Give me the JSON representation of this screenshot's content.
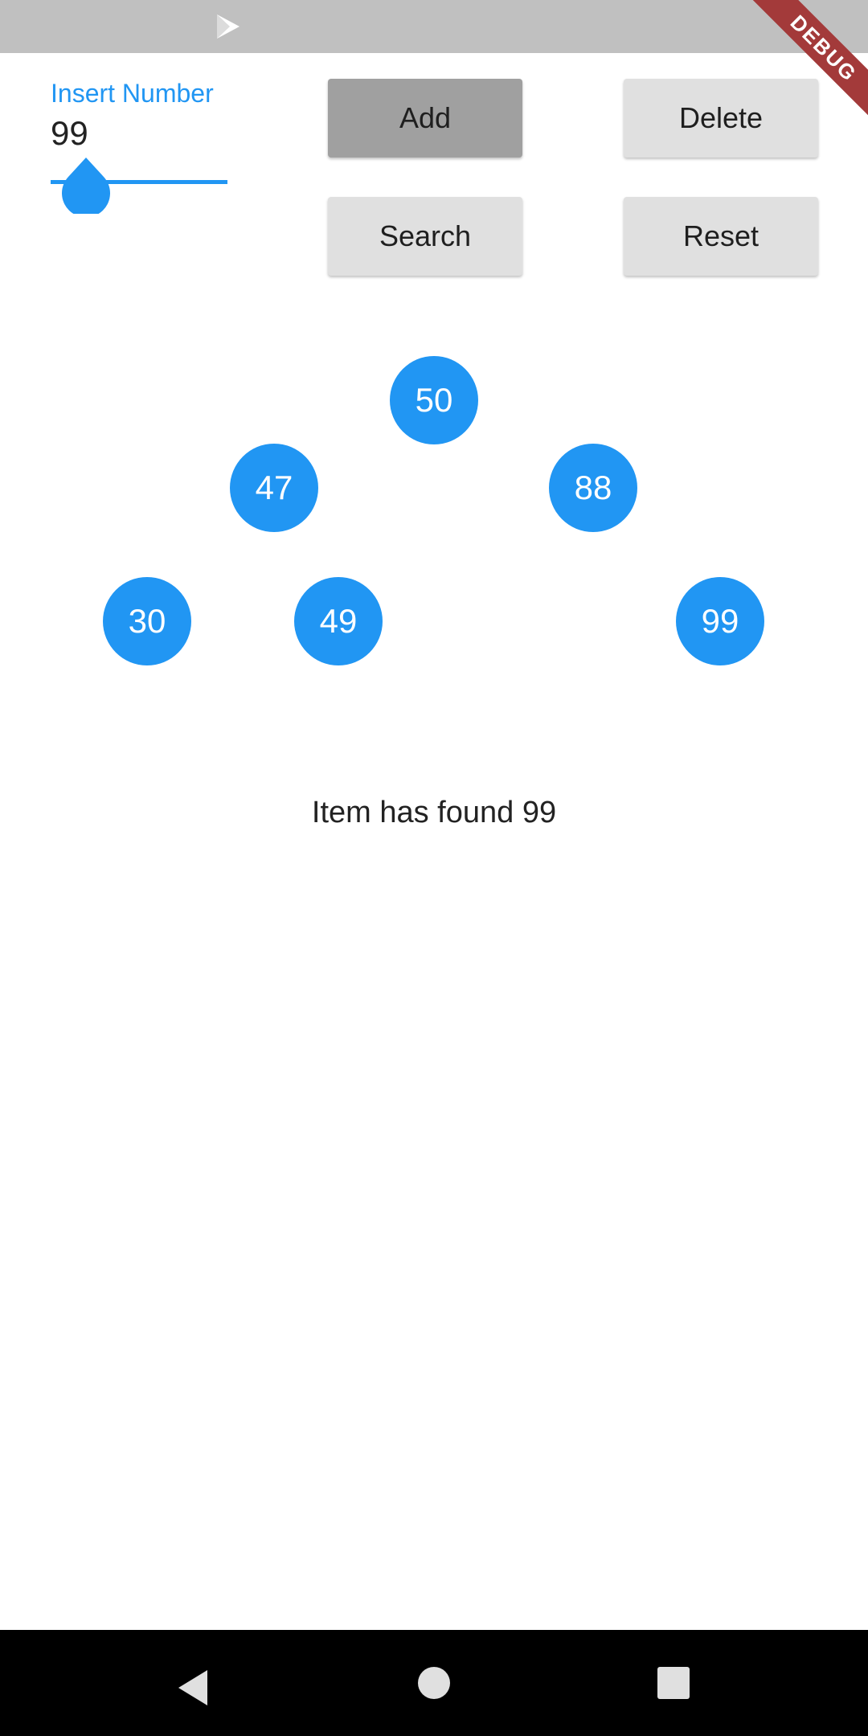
{
  "status_bar": {
    "icon": "play-store-icon"
  },
  "debug_banner": {
    "label": "DEBUG",
    "color": "#a33a3a"
  },
  "insert": {
    "label": "Insert Number",
    "value": "99",
    "slider_value": 99,
    "slider_fraction": 0.2
  },
  "buttons": {
    "add": "Add",
    "delete": "Delete",
    "search": "Search",
    "reset": "Reset"
  },
  "tree": {
    "nodes": [
      "50",
      "47",
      "88",
      "30",
      "49",
      "99"
    ],
    "node_color": "#2196f3"
  },
  "result": {
    "text": "Item has found 99"
  },
  "nav": {
    "back_icon": "back-icon",
    "home_icon": "home-icon",
    "recent_icon": "recent-apps-icon"
  },
  "colors": {
    "accent": "#2196f3",
    "button_bg": "#e0e0e0",
    "button_pressed": "#a0a0a0"
  }
}
